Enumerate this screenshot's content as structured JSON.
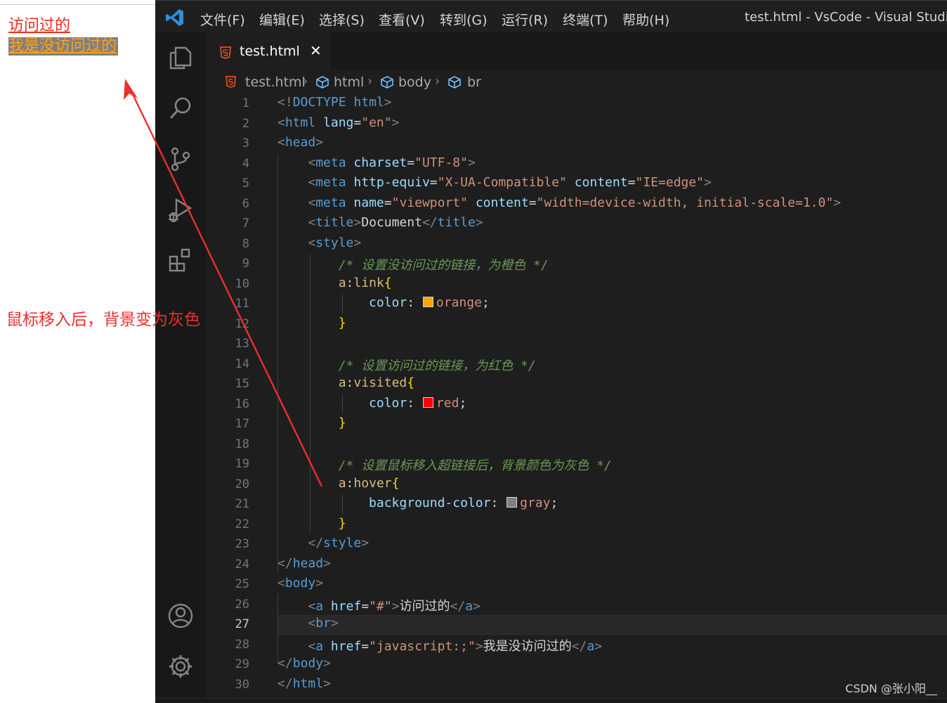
{
  "browser_preview": {
    "link_visited": "访问过的",
    "link_unvisited": "我是没访问过的",
    "annotation": "鼠标移入后，背景变为灰色",
    "colors": {
      "visited": "#f02b1d",
      "link": "#ffa21a",
      "hover_bg": "#808080",
      "annotation": "#ee2d2d"
    }
  },
  "vscode": {
    "menu": [
      "文件(F)",
      "编辑(E)",
      "选择(S)",
      "查看(V)",
      "转到(G)",
      "运行(R)",
      "终端(T)",
      "帮助(H)"
    ],
    "window_title": "test.html - VsCode - Visual Studio Co",
    "activity_icons": [
      "explorer-icon",
      "search-icon",
      "source-control-icon",
      "run-debug-icon",
      "extensions-icon",
      "account-icon",
      "settings-gear-icon"
    ],
    "tab": {
      "label": "test.html",
      "close": "✕"
    },
    "breadcrumb": [
      "test.html",
      "html",
      "body",
      "br"
    ],
    "active_line": 27,
    "lines": [
      {
        "num": "1",
        "segments": [
          [
            "br",
            "<!"
          ],
          [
            "doctype",
            "DOCTYPE"
          ],
          [
            "txt",
            " "
          ],
          [
            "tag",
            "html"
          ],
          [
            "br",
            ">"
          ]
        ]
      },
      {
        "num": "2",
        "segments": [
          [
            "br",
            "<"
          ],
          [
            "tag",
            "html"
          ],
          [
            "txt",
            " "
          ],
          [
            "attr",
            "lang"
          ],
          [
            "punc",
            "="
          ],
          [
            "str",
            "\"en\""
          ],
          [
            "br",
            ">"
          ]
        ]
      },
      {
        "num": "3",
        "segments": [
          [
            "br",
            "<"
          ],
          [
            "tag",
            "head"
          ],
          [
            "br",
            ">"
          ]
        ]
      },
      {
        "num": "4",
        "segments": [
          [
            "txt",
            "    "
          ],
          [
            "br",
            "<"
          ],
          [
            "tag",
            "meta"
          ],
          [
            "txt",
            " "
          ],
          [
            "attr",
            "charset"
          ],
          [
            "punc",
            "="
          ],
          [
            "str",
            "\"UTF-8\""
          ],
          [
            "br",
            ">"
          ]
        ]
      },
      {
        "num": "5",
        "segments": [
          [
            "txt",
            "    "
          ],
          [
            "br",
            "<"
          ],
          [
            "tag",
            "meta"
          ],
          [
            "txt",
            " "
          ],
          [
            "attr",
            "http-equiv"
          ],
          [
            "punc",
            "="
          ],
          [
            "str",
            "\"X-UA-Compatible\""
          ],
          [
            "txt",
            " "
          ],
          [
            "attr",
            "content"
          ],
          [
            "punc",
            "="
          ],
          [
            "str",
            "\"IE=edge\""
          ],
          [
            "br",
            ">"
          ]
        ]
      },
      {
        "num": "6",
        "segments": [
          [
            "txt",
            "    "
          ],
          [
            "br",
            "<"
          ],
          [
            "tag",
            "meta"
          ],
          [
            "txt",
            " "
          ],
          [
            "attr",
            "name"
          ],
          [
            "punc",
            "="
          ],
          [
            "str",
            "\"viewport\""
          ],
          [
            "txt",
            " "
          ],
          [
            "attr",
            "content"
          ],
          [
            "punc",
            "="
          ],
          [
            "str",
            "\"width=device-width, initial-scale=1.0\""
          ],
          [
            "br",
            ">"
          ]
        ]
      },
      {
        "num": "7",
        "segments": [
          [
            "txt",
            "    "
          ],
          [
            "br",
            "<"
          ],
          [
            "tag",
            "title"
          ],
          [
            "br",
            ">"
          ],
          [
            "txt",
            "Document"
          ],
          [
            "br",
            "</"
          ],
          [
            "tag",
            "title"
          ],
          [
            "br",
            ">"
          ]
        ]
      },
      {
        "num": "8",
        "segments": [
          [
            "txt",
            "    "
          ],
          [
            "br",
            "<"
          ],
          [
            "tag",
            "style"
          ],
          [
            "br",
            ">"
          ]
        ]
      },
      {
        "num": "9",
        "segments": [
          [
            "txt",
            "        "
          ],
          [
            "cmt",
            "/* 设置没访问过的链接，为橙色 */"
          ]
        ]
      },
      {
        "num": "10",
        "segments": [
          [
            "txt",
            "        "
          ],
          [
            "sel",
            "a"
          ],
          [
            "punc",
            ":"
          ],
          [
            "pseudo",
            "link"
          ],
          [
            "bt",
            "{"
          ]
        ]
      },
      {
        "num": "11",
        "segments": [
          [
            "txt",
            "            "
          ],
          [
            "prop",
            "color"
          ],
          [
            "punc",
            ": "
          ],
          [
            "swatch",
            "#ffa500"
          ],
          [
            "val",
            "orange"
          ],
          [
            "punc",
            ";"
          ]
        ]
      },
      {
        "num": "12",
        "segments": [
          [
            "txt",
            "        "
          ],
          [
            "bt",
            "}"
          ]
        ]
      },
      {
        "num": "13",
        "segments": []
      },
      {
        "num": "14",
        "segments": [
          [
            "txt",
            "        "
          ],
          [
            "cmt",
            "/* 设置访问过的链接，为红色 */"
          ]
        ]
      },
      {
        "num": "15",
        "segments": [
          [
            "txt",
            "        "
          ],
          [
            "sel",
            "a"
          ],
          [
            "punc",
            ":"
          ],
          [
            "pseudo",
            "visited"
          ],
          [
            "bt",
            "{"
          ]
        ]
      },
      {
        "num": "16",
        "segments": [
          [
            "txt",
            "            "
          ],
          [
            "prop",
            "color"
          ],
          [
            "punc",
            ": "
          ],
          [
            "swatch",
            "#ff0000"
          ],
          [
            "val",
            "red"
          ],
          [
            "punc",
            ";"
          ]
        ]
      },
      {
        "num": "17",
        "segments": [
          [
            "txt",
            "        "
          ],
          [
            "bt",
            "}"
          ]
        ]
      },
      {
        "num": "18",
        "segments": []
      },
      {
        "num": "19",
        "segments": [
          [
            "txt",
            "        "
          ],
          [
            "cmt",
            "/* 设置鼠标移入超链接后，背景颜色为灰色 */"
          ]
        ]
      },
      {
        "num": "20",
        "segments": [
          [
            "txt",
            "        "
          ],
          [
            "sel",
            "a"
          ],
          [
            "punc",
            ":"
          ],
          [
            "pseudo",
            "hover"
          ],
          [
            "bt",
            "{"
          ]
        ]
      },
      {
        "num": "21",
        "segments": [
          [
            "txt",
            "            "
          ],
          [
            "prop",
            "background-color"
          ],
          [
            "punc",
            ": "
          ],
          [
            "swatch",
            "#808080"
          ],
          [
            "val",
            "gray"
          ],
          [
            "punc",
            ";"
          ]
        ]
      },
      {
        "num": "22",
        "segments": [
          [
            "txt",
            "        "
          ],
          [
            "bt",
            "}"
          ]
        ]
      },
      {
        "num": "23",
        "segments": [
          [
            "txt",
            "    "
          ],
          [
            "br",
            "</"
          ],
          [
            "tag",
            "style"
          ],
          [
            "br",
            ">"
          ]
        ]
      },
      {
        "num": "24",
        "segments": [
          [
            "br",
            "</"
          ],
          [
            "tag",
            "head"
          ],
          [
            "br",
            ">"
          ]
        ]
      },
      {
        "num": "25",
        "segments": [
          [
            "br",
            "<"
          ],
          [
            "tag",
            "body"
          ],
          [
            "br",
            ">"
          ]
        ]
      },
      {
        "num": "26",
        "segments": [
          [
            "txt",
            "    "
          ],
          [
            "br",
            "<"
          ],
          [
            "tag",
            "a"
          ],
          [
            "txt",
            " "
          ],
          [
            "attr",
            "href"
          ],
          [
            "punc",
            "="
          ],
          [
            "str",
            "\"#\""
          ],
          [
            "br",
            ">"
          ],
          [
            "txt",
            "访问过的"
          ],
          [
            "br",
            "</"
          ],
          [
            "tag",
            "a"
          ],
          [
            "br",
            ">"
          ]
        ]
      },
      {
        "num": "27",
        "segments": [
          [
            "txt",
            "    "
          ],
          [
            "br",
            "<"
          ],
          [
            "tag",
            "br"
          ],
          [
            "br",
            ">"
          ]
        ]
      },
      {
        "num": "28",
        "segments": [
          [
            "txt",
            "    "
          ],
          [
            "br",
            "<"
          ],
          [
            "tag",
            "a"
          ],
          [
            "txt",
            " "
          ],
          [
            "attr",
            "href"
          ],
          [
            "punc",
            "="
          ],
          [
            "str",
            "\"javascript:;\""
          ],
          [
            "br",
            ">"
          ],
          [
            "txt",
            "我是没访问过的"
          ],
          [
            "br",
            "</"
          ],
          [
            "tag",
            "a"
          ],
          [
            "br",
            ">"
          ]
        ]
      },
      {
        "num": "29",
        "segments": [
          [
            "br",
            "</"
          ],
          [
            "tag",
            "body"
          ],
          [
            "br",
            ">"
          ]
        ]
      },
      {
        "num": "30",
        "segments": [
          [
            "br",
            "</"
          ],
          [
            "tag",
            "html"
          ],
          [
            "br",
            ">"
          ]
        ]
      }
    ]
  },
  "watermark": "CSDN @张小阳__"
}
